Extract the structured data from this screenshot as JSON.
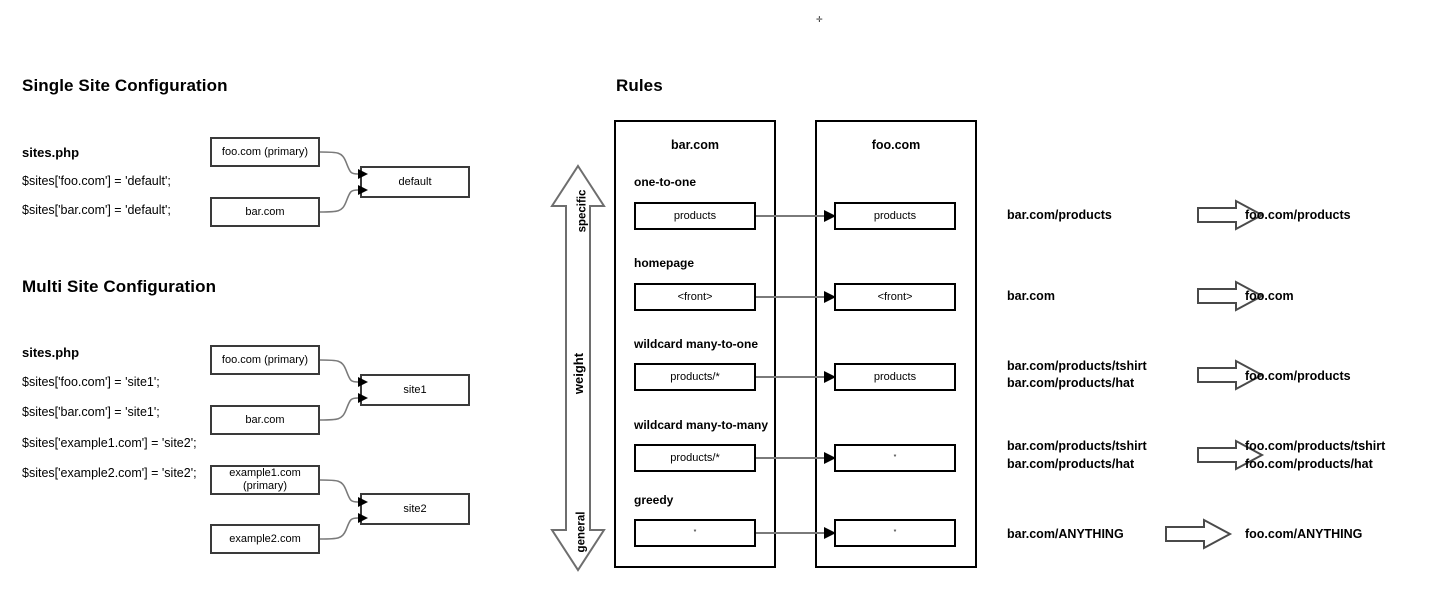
{
  "page": {
    "top_mark": "✛"
  },
  "single_site": {
    "title": "Single Site Configuration",
    "file_label": "sites.php",
    "code": [
      "$sites['foo.com'] = 'default';",
      "$sites['bar.com'] = 'default';"
    ],
    "sources": [
      "foo.com (primary)",
      "bar.com"
    ],
    "target": "default"
  },
  "multi_site": {
    "title": "Multi Site Configuration",
    "file_label": "sites.php",
    "code": [
      "$sites['foo.com'] = 'site1';",
      "$sites['bar.com'] = 'site1';",
      "$sites['example1.com'] = 'site2';",
      "$sites['example2.com'] = 'site2';"
    ],
    "groups": [
      {
        "sources": [
          "foo.com (primary)",
          "bar.com"
        ],
        "target": "site1"
      },
      {
        "sources": [
          "example1.com (primary)",
          "example2.com"
        ],
        "target": "site2"
      }
    ]
  },
  "rules": {
    "title": "Rules",
    "weight_axis": {
      "top_label": "specific",
      "middle_label": "weight",
      "bottom_label": "general"
    },
    "source_panel_title": "bar.com",
    "target_panel_title": "foo.com",
    "rows": [
      {
        "rule_label": "one-to-one",
        "source_path": "products",
        "target_path": "products",
        "example_from": [
          "bar.com/products"
        ],
        "example_to": [
          "foo.com/products"
        ]
      },
      {
        "rule_label": "homepage",
        "source_path": "<front>",
        "target_path": "<front>",
        "example_from": [
          "bar.com"
        ],
        "example_to": [
          "foo.com"
        ]
      },
      {
        "rule_label": "wildcard many-to-one",
        "source_path": "products/*",
        "target_path": "products",
        "example_from": [
          "bar.com/products/tshirt",
          "bar.com/products/hat"
        ],
        "example_to": [
          "foo.com/products"
        ]
      },
      {
        "rule_label": "wildcard many-to-many",
        "source_path": "products/*",
        "target_path": "*",
        "example_from": [
          "bar.com/products/tshirt",
          "bar.com/products/hat"
        ],
        "example_to": [
          "foo.com/products/tshirt",
          "foo.com/products/hat"
        ]
      },
      {
        "rule_label": "greedy",
        "source_path": "*",
        "target_path": "*",
        "example_from": [
          "bar.com/ANYTHING"
        ],
        "example_to": [
          "foo.com/ANYTHING"
        ]
      }
    ]
  },
  "colors": {
    "ink": "#000000",
    "box_stroke": "#3a3a3a",
    "connector": "#7a7a7a",
    "background": "#ffffff"
  }
}
